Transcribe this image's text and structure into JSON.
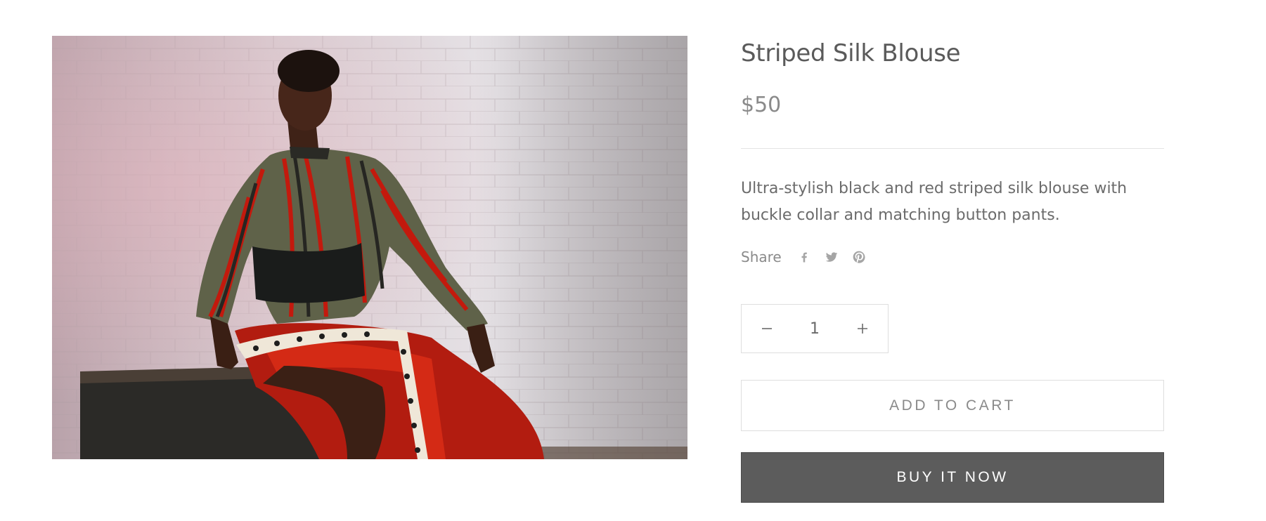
{
  "product": {
    "title": "Striped Silk Blouse",
    "price": "$50",
    "description": "Ultra-stylish black and red striped silk blouse with buckle collar and matching button pants.",
    "image": {
      "description": "Model seated on a wooden crate in front of a white brick wall, wearing a striped silk blouse and red button pants"
    }
  },
  "share": {
    "label": "Share",
    "icons": [
      "facebook-icon",
      "twitter-icon",
      "pinterest-icon"
    ]
  },
  "quantity": {
    "value": "1",
    "decrease_icon": "minus-icon",
    "increase_icon": "plus-icon"
  },
  "actions": {
    "add_to_cart": "ADD TO CART",
    "buy_now": "BUY IT NOW"
  },
  "colors": {
    "text": "#5c5c5c",
    "muted": "#8a8a8a",
    "buy_button_bg": "#5c5c5c",
    "border": "#dedede"
  }
}
